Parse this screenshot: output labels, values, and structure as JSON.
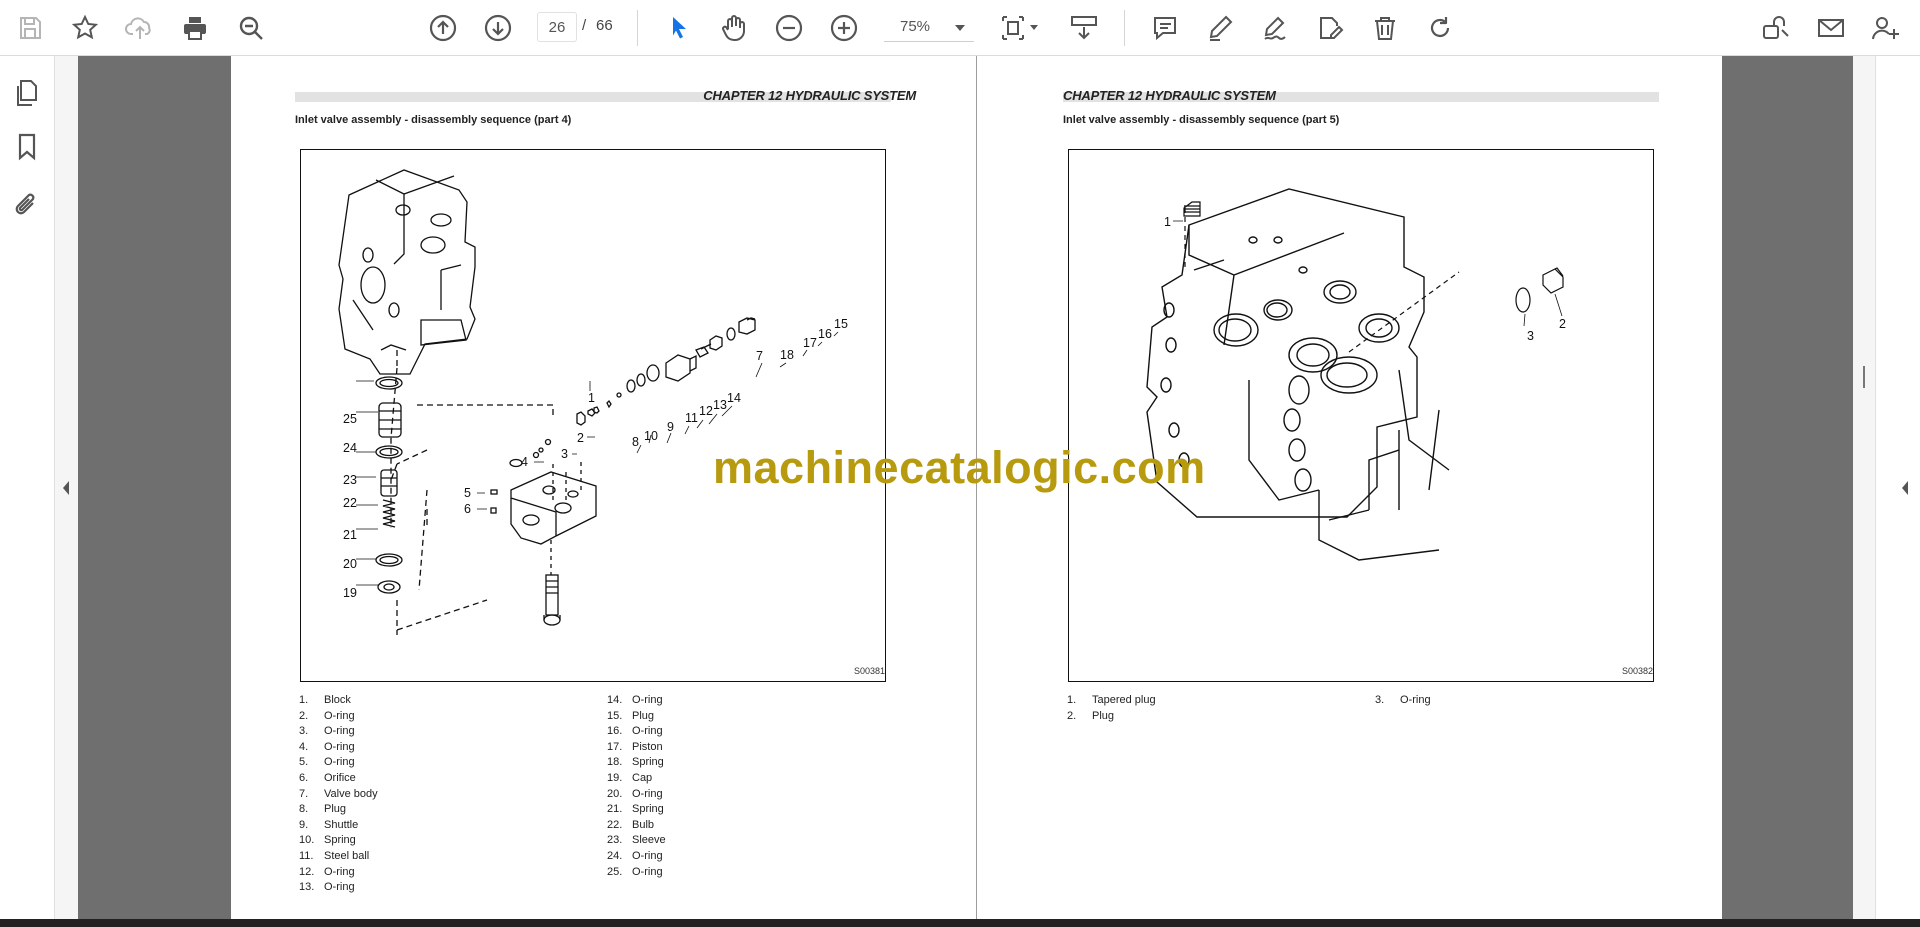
{
  "toolbar": {
    "page_current": "26",
    "page_separator": "/",
    "page_total": "66",
    "zoom": "75%"
  },
  "colors": {
    "accent_blue": "#1473e6",
    "icon_gray": "#555555",
    "watermark": "#b79a0e",
    "workspace_gray": "#6f6f6f"
  },
  "icons": {
    "toolbar": [
      "save-icon",
      "bookmark-star-icon",
      "cloud-upload-icon",
      "print-icon",
      "zoom-search-icon",
      "page-up-icon",
      "page-down-icon",
      "select-cursor-icon",
      "hand-tool-icon",
      "zoom-out-icon",
      "zoom-in-icon",
      "fit-page-icon",
      "scroll-mode-icon",
      "comment-icon",
      "highlight-pen-icon",
      "draw-signature-icon",
      "edit-document-icon",
      "delete-icon",
      "rotate-icon",
      "share-link-icon",
      "email-icon",
      "add-user-icon"
    ],
    "left_rail": [
      "pages-thumbnails-icon",
      "bookmarks-icon",
      "attachments-icon"
    ]
  },
  "left_page": {
    "chapter": "CHAPTER 12  HYDRAULIC SYSTEM",
    "section": "Inlet valve assembly - disassembly sequence (part 4)",
    "figure_code": "S00381",
    "callouts": [
      "1",
      "2",
      "3",
      "4",
      "5",
      "6",
      "7",
      "8",
      "9",
      "10",
      "11",
      "12",
      "13",
      "14",
      "15",
      "16",
      "17",
      "18",
      "19",
      "20",
      "21",
      "22",
      "23",
      "24",
      "25"
    ],
    "legend_col1": [
      {
        "num": "1.",
        "label": "Block"
      },
      {
        "num": "2.",
        "label": "O-ring"
      },
      {
        "num": "3.",
        "label": "O-ring"
      },
      {
        "num": "4.",
        "label": "O-ring"
      },
      {
        "num": "5.",
        "label": "O-ring"
      },
      {
        "num": "6.",
        "label": "Orifice"
      },
      {
        "num": "7.",
        "label": "Valve body"
      },
      {
        "num": "8.",
        "label": "Plug"
      },
      {
        "num": "9.",
        "label": "Shuttle"
      },
      {
        "num": "10.",
        "label": "Spring"
      },
      {
        "num": "11.",
        "label": "Steel ball"
      },
      {
        "num": "12.",
        "label": "O-ring"
      },
      {
        "num": "13.",
        "label": "O-ring"
      }
    ],
    "legend_col2": [
      {
        "num": "14.",
        "label": "O-ring"
      },
      {
        "num": "15.",
        "label": "Plug"
      },
      {
        "num": "16.",
        "label": "O-ring"
      },
      {
        "num": "17.",
        "label": "Piston"
      },
      {
        "num": "18.",
        "label": "Spring"
      },
      {
        "num": "19.",
        "label": "Cap"
      },
      {
        "num": "20.",
        "label": "O-ring"
      },
      {
        "num": "21.",
        "label": "Spring"
      },
      {
        "num": "22.",
        "label": "Bulb"
      },
      {
        "num": "23.",
        "label": "Sleeve"
      },
      {
        "num": "24.",
        "label": "O-ring"
      },
      {
        "num": "25.",
        "label": "O-ring"
      }
    ]
  },
  "right_page": {
    "chapter": "CHAPTER 12  HYDRAULIC SYSTEM",
    "section": "Inlet valve assembly - disassembly sequence (part 5)",
    "figure_code": "S00382",
    "callouts": [
      "1",
      "2",
      "3"
    ],
    "legend_col1": [
      {
        "num": "1.",
        "label": "Tapered plug"
      },
      {
        "num": "2.",
        "label": "Plug"
      }
    ],
    "legend_col2": [
      {
        "num": "3.",
        "label": "O-ring"
      }
    ]
  },
  "watermark": "machinecatalogic.com"
}
